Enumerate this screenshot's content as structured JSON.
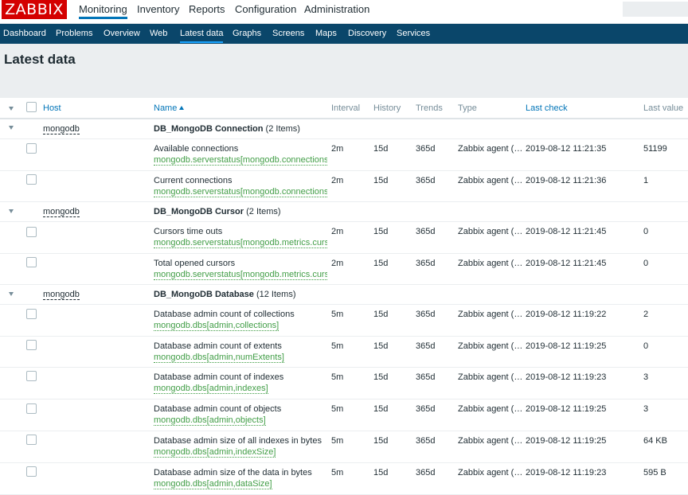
{
  "brand": {
    "logo": "ZABBIX"
  },
  "top_menu": [
    "Monitoring",
    "Inventory",
    "Reports",
    "Configuration",
    "Administration"
  ],
  "sub_menu": [
    "Dashboard",
    "Problems",
    "Overview",
    "Web",
    "Latest data",
    "Graphs",
    "Screens",
    "Maps",
    "Discovery",
    "Services"
  ],
  "page": {
    "title": "Latest data"
  },
  "table": {
    "headers": {
      "host": "Host",
      "name": "Name",
      "interval": "Interval",
      "history": "History",
      "trends": "Trends",
      "type": "Type",
      "last_check": "Last check",
      "last_value": "Last value"
    },
    "groups": [
      {
        "host": "mongodb",
        "name": "DB_MongoDB Connection",
        "count": "(2 Items)",
        "items": [
          {
            "name": "Available connections",
            "key": "mongodb.serverstatus[mongodb.connections.available]",
            "interval": "2m",
            "history": "15d",
            "trends": "365d",
            "type": "Zabbix agent (…",
            "last_check": "2019-08-12 11:21:35",
            "last_value": "51199"
          },
          {
            "name": "Current connections",
            "key": "mongodb.serverstatus[mongodb.connections.current]",
            "interval": "2m",
            "history": "15d",
            "trends": "365d",
            "type": "Zabbix agent (…",
            "last_check": "2019-08-12 11:21:36",
            "last_value": "1"
          }
        ]
      },
      {
        "host": "mongodb",
        "name": "DB_MongoDB Cursor",
        "count": "(2 Items)",
        "items": [
          {
            "name": "Cursors time outs",
            "key": "mongodb.serverstatus[mongodb.metrics.cursor.timedOut]",
            "interval": "2m",
            "history": "15d",
            "trends": "365d",
            "type": "Zabbix agent (…",
            "last_check": "2019-08-12 11:21:45",
            "last_value": "0"
          },
          {
            "name": "Total opened cursors",
            "key": "mongodb.serverstatus[mongodb.metrics.cursor.open.total]",
            "interval": "2m",
            "history": "15d",
            "trends": "365d",
            "type": "Zabbix agent (…",
            "last_check": "2019-08-12 11:21:45",
            "last_value": "0"
          }
        ]
      },
      {
        "host": "mongodb",
        "name": "DB_MongoDB Database",
        "count": "(12 Items)",
        "items": [
          {
            "name": "Database admin count of collections",
            "key": "mongodb.dbs[admin,collections]",
            "interval": "5m",
            "history": "15d",
            "trends": "365d",
            "type": "Zabbix agent (…",
            "last_check": "2019-08-12 11:19:22",
            "last_value": "2"
          },
          {
            "name": "Database admin count of extents",
            "key": "mongodb.dbs[admin,numExtents]",
            "interval": "5m",
            "history": "15d",
            "trends": "365d",
            "type": "Zabbix agent (…",
            "last_check": "2019-08-12 11:19:25",
            "last_value": "0"
          },
          {
            "name": "Database admin count of indexes",
            "key": "mongodb.dbs[admin,indexes]",
            "interval": "5m",
            "history": "15d",
            "trends": "365d",
            "type": "Zabbix agent (…",
            "last_check": "2019-08-12 11:19:23",
            "last_value": "3"
          },
          {
            "name": "Database admin count of objects",
            "key": "mongodb.dbs[admin,objects]",
            "interval": "5m",
            "history": "15d",
            "trends": "365d",
            "type": "Zabbix agent (…",
            "last_check": "2019-08-12 11:19:25",
            "last_value": "3"
          },
          {
            "name": "Database admin size of all indexes in bytes",
            "key": "mongodb.dbs[admin,indexSize]",
            "interval": "5m",
            "history": "15d",
            "trends": "365d",
            "type": "Zabbix agent (…",
            "last_check": "2019-08-12 11:19:25",
            "last_value": "64 KB"
          },
          {
            "name": "Database admin size of the data in bytes",
            "key": "mongodb.dbs[admin,dataSize]",
            "interval": "5m",
            "history": "15d",
            "trends": "365d",
            "type": "Zabbix agent (…",
            "last_check": "2019-08-12 11:19:23",
            "last_value": "595 B"
          }
        ]
      }
    ]
  }
}
